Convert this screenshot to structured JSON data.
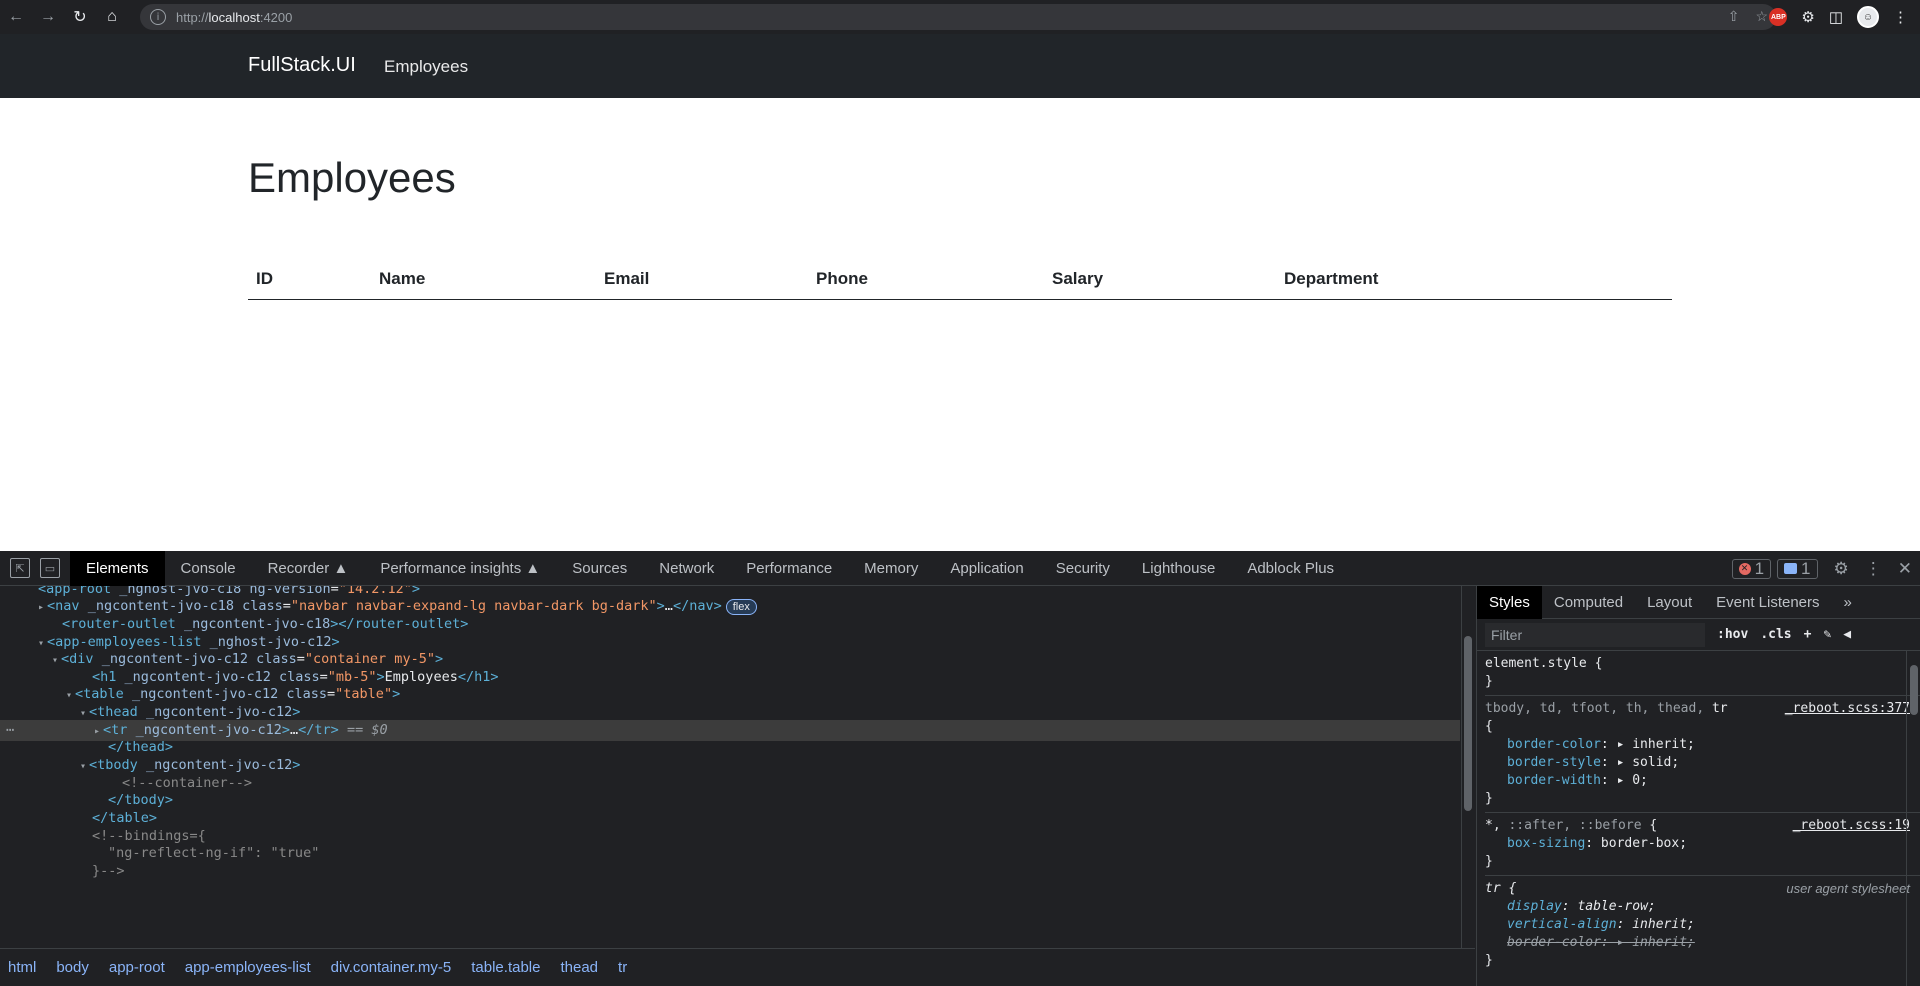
{
  "browser": {
    "url_scheme": "http://",
    "url_host": "localhost",
    "url_port": ":4200"
  },
  "app": {
    "brand": "FullStack.UI",
    "nav_link": "Employees",
    "page_title": "Employees",
    "table_headers": [
      "ID",
      "Name",
      "Email",
      "Phone",
      "Salary",
      "Department"
    ]
  },
  "devtools": {
    "tabs": [
      "Elements",
      "Console",
      "Recorder",
      "Performance insights",
      "Sources",
      "Network",
      "Performance",
      "Memory",
      "Application",
      "Security",
      "Lighthouse",
      "Adblock Plus"
    ],
    "error_count": "1",
    "message_count": "1",
    "dom_lines": [
      {
        "indent": 38,
        "html": "<span class='tag'>&lt;app-root</span> <span class='attr'>_nghost-jvo-c18 ng-version</span>=<span class='aval'>\"14.2.12\"</span><span class='tag'>&gt;</span>"
      },
      {
        "indent": 52,
        "html": "<span class='tag'>&lt;nav</span> <span class='attr'>_ngcontent-jvo-c18 class</span>=<span class='aval'>\"navbar navbar-expand-lg navbar-dark bg-dark\"</span><span class='tag'>&gt;</span><span class='txt'>…</span><span class='tag'>&lt;/nav&gt;</span>"
      },
      {
        "indent": 62,
        "html": "<span class='tag'>&lt;router-outlet</span> <span class='attr'>_ngcontent-jvo-c18</span><span class='tag'>&gt;&lt;/router-outlet&gt;</span>"
      },
      {
        "indent": 52,
        "html": "<span class='tag'>&lt;app-employees-list</span> <span class='attr'>_nghost-jvo-c12</span><span class='tag'>&gt;</span>"
      },
      {
        "indent": 66,
        "html": "<span class='tag'>&lt;div</span> <span class='attr'>_ngcontent-jvo-c12 class</span>=<span class='aval'>\"container my-5\"</span><span class='tag'>&gt;</span>"
      },
      {
        "indent": 92,
        "html": "<span class='tag'>&lt;h1</span> <span class='attr'>_ngcontent-jvo-c12 class</span>=<span class='aval'>\"mb-5\"</span><span class='tag'>&gt;</span><span class='txt'>Employees</span><span class='tag'>&lt;/h1&gt;</span>"
      },
      {
        "indent": 80,
        "html": "<span class='tag'>&lt;table</span> <span class='attr'>_ngcontent-jvo-c12 class</span>=<span class='aval'>\"table\"</span><span class='tag'>&gt;</span>"
      },
      {
        "indent": 94,
        "html": "<span class='tag'>&lt;thead</span> <span class='attr'>_ngcontent-jvo-c12</span><span class='tag'>&gt;</span>"
      },
      {
        "indent": 108,
        "html": "<span class='tag'>&lt;tr</span> <span class='attr'>_ngcontent-jvo-c12</span><span class='tag'>&gt;</span><span class='txt'>…</span><span class='tag'>&lt;/tr&gt;</span>"
      },
      {
        "indent": 108,
        "html": "<span class='tag'>&lt;/thead&gt;</span>"
      },
      {
        "indent": 94,
        "html": "<span class='tag'>&lt;tbody</span> <span class='attr'>_ngcontent-jvo-c12</span><span class='tag'>&gt;</span>"
      },
      {
        "indent": 122,
        "html": "<span class='cmt'>&lt;!--container--&gt;</span>"
      },
      {
        "indent": 108,
        "html": "<span class='tag'>&lt;/tbody&gt;</span>"
      },
      {
        "indent": 92,
        "html": "<span class='tag'>&lt;/table&gt;</span>"
      },
      {
        "indent": 92,
        "html": "<span class='cmt'>&lt;!--bindings={</span>"
      },
      {
        "indent": 108,
        "html": "<span class='cmt'>\"ng-reflect-ng-if\": \"true\"</span>"
      },
      {
        "indent": 92,
        "html": "<span class='cmt'>}--&gt;</span>"
      }
    ],
    "breadcrumbs": [
      "html",
      "body",
      "app-root",
      "app-employees-list",
      "div.container.my-5",
      "table.table",
      "thead",
      "tr"
    ],
    "styles_tabs": [
      "Styles",
      "Computed",
      "Layout",
      "Event Listeners"
    ],
    "filter_placeholder": "Filter",
    "hov": ":hov",
    "cls": ".cls",
    "selected_suffix": "== $0",
    "flex_badge": "flex"
  }
}
